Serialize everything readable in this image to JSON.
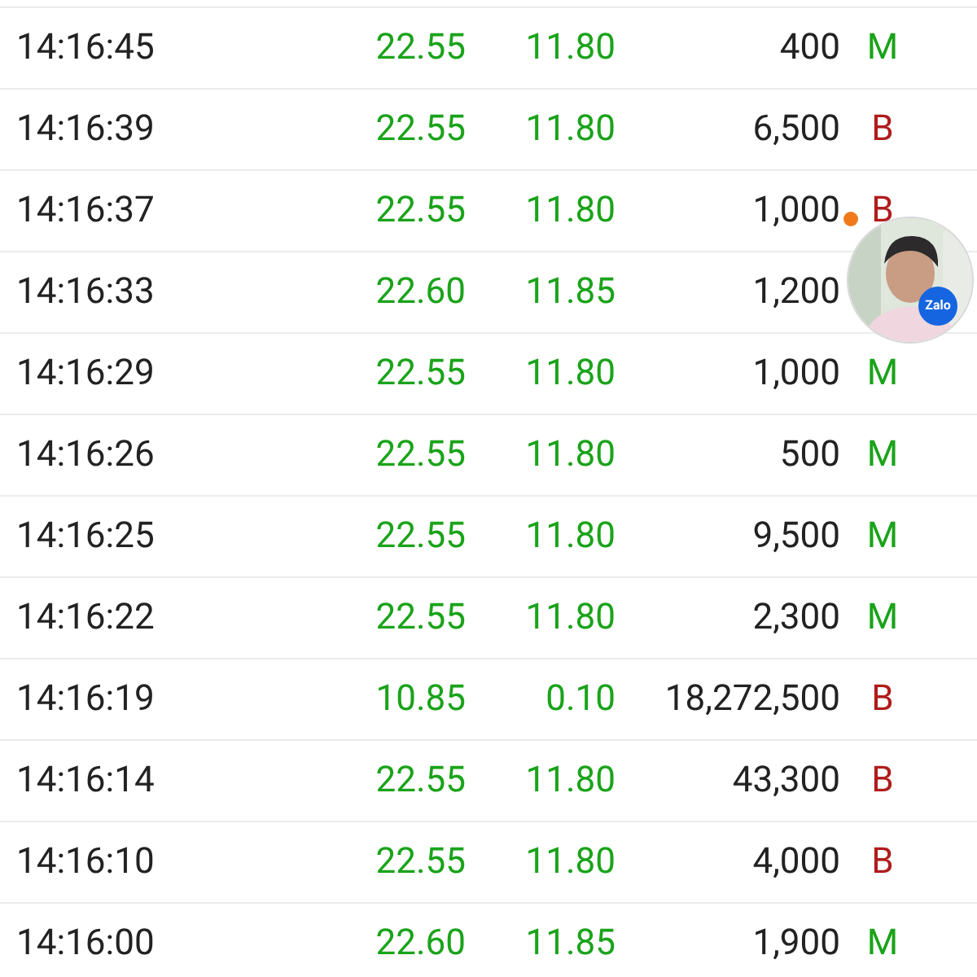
{
  "trades": [
    {
      "time": "14:16:45",
      "price": "22.55",
      "change": "11.80",
      "volume": "400",
      "side": "M",
      "color": "#1aa31a"
    },
    {
      "time": "14:16:39",
      "price": "22.55",
      "change": "11.80",
      "volume": "6,500",
      "side": "B",
      "color": "#b01c1c"
    },
    {
      "time": "14:16:37",
      "price": "22.55",
      "change": "11.80",
      "volume": "1,000",
      "side": "B",
      "color": "#b01c1c"
    },
    {
      "time": "14:16:33",
      "price": "22.60",
      "change": "11.85",
      "volume": "1,200"
    },
    {
      "time": "14:16:29",
      "price": "22.55",
      "change": "11.80",
      "volume": "1,000",
      "side": "M",
      "color": "#1aa31a"
    },
    {
      "time": "14:16:26",
      "price": "22.55",
      "change": "11.80",
      "volume": "500",
      "side": "M",
      "color": "#1aa31a"
    },
    {
      "time": "14:16:25",
      "price": "22.55",
      "change": "11.80",
      "volume": "9,500",
      "side": "M",
      "color": "#1aa31a"
    },
    {
      "time": "14:16:22",
      "price": "22.55",
      "change": "11.80",
      "volume": "2,300",
      "side": "M",
      "color": "#1aa31a"
    },
    {
      "time": "14:16:19",
      "price": "10.85",
      "change": "0.10",
      "volume": "18,272,500",
      "side": "B",
      "color": "#b01c1c"
    },
    {
      "time": "14:16:14",
      "price": "22.55",
      "change": "11.80",
      "volume": "43,300",
      "side": "B",
      "color": "#b01c1c"
    },
    {
      "time": "14:16:10",
      "price": "22.55",
      "change": "11.80",
      "volume": "4,000",
      "side": "B",
      "color": "#b01c1c"
    },
    {
      "time": "14:16:00",
      "price": "22.60",
      "change": "11.85",
      "volume": "1,900",
      "side": "M",
      "color": "#1aa31a"
    }
  ],
  "chat_bubble": {
    "badge": "Zalo",
    "unread": true
  }
}
